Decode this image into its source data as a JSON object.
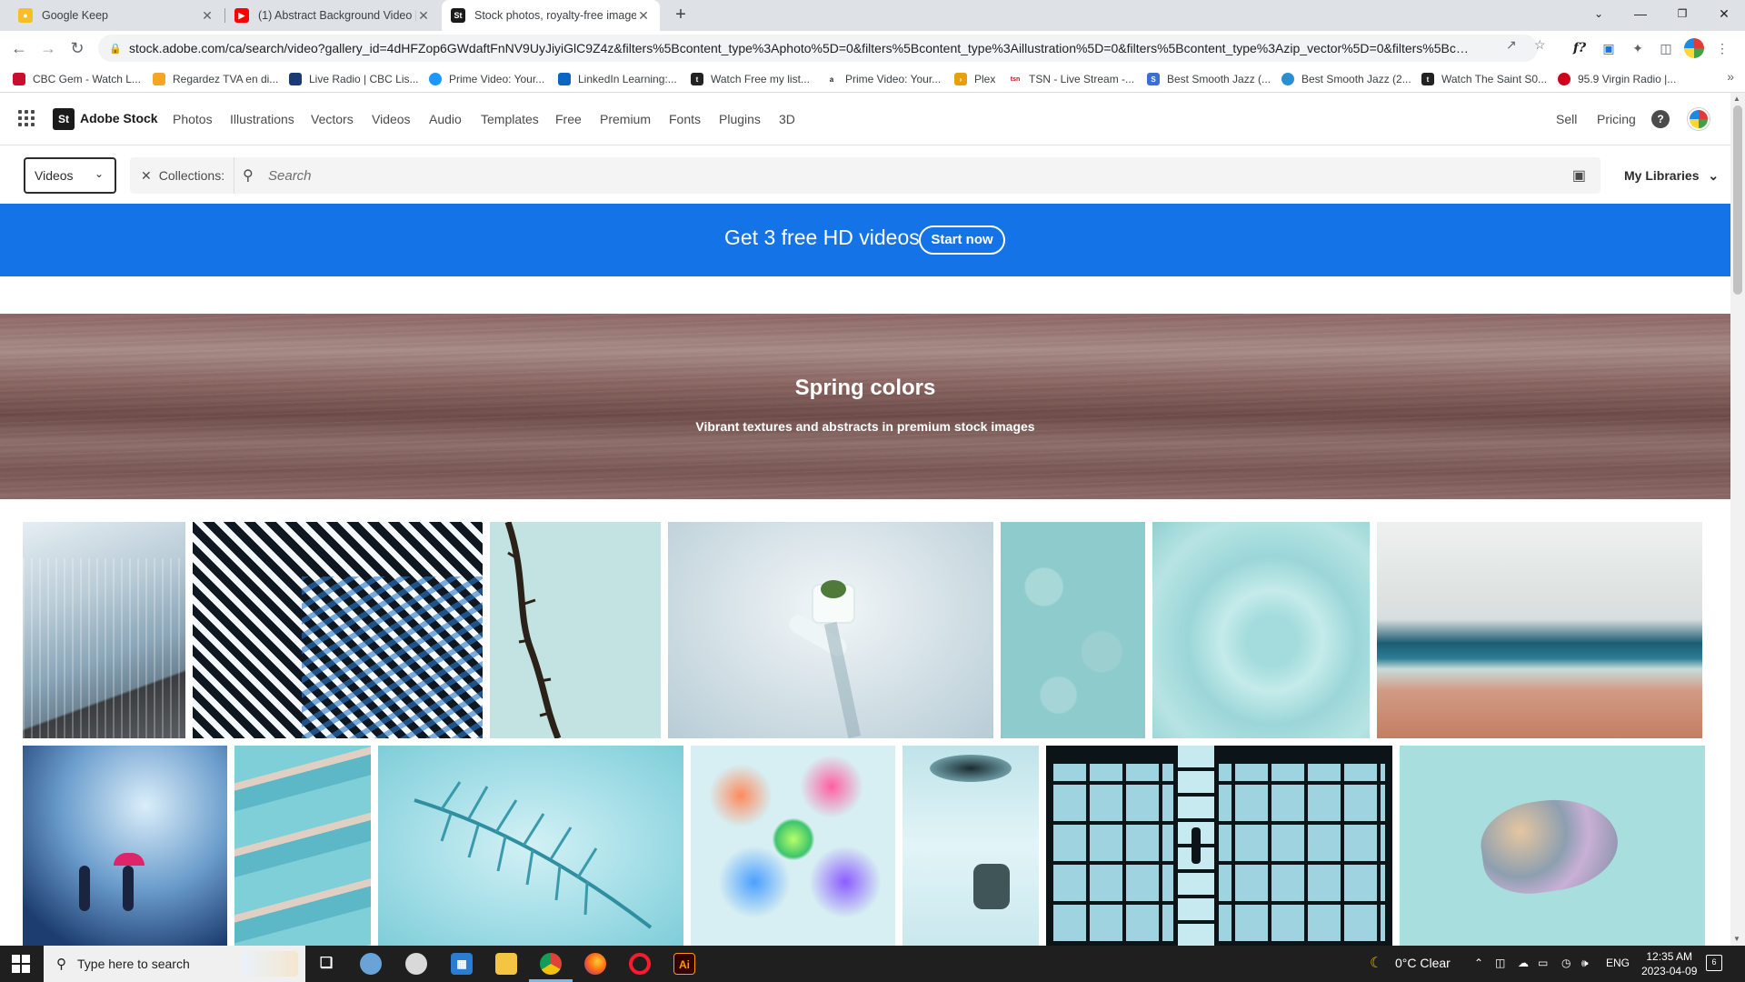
{
  "browser": {
    "tabs": [
      {
        "title": "Google Keep",
        "favicon": "keep-icon"
      },
      {
        "title": "(1) Abstract Background Video | ",
        "favicon": "youtube-icon"
      },
      {
        "title": "Stock photos, royalty-free image",
        "favicon": "adobe-stock-icon"
      }
    ],
    "url": "stock.adobe.com/ca/search/video?gallery_id=4dHFZop6GWdaftFnNV9UyJiyiGlC9Z4z&filters%5Bcontent_type%3Aphoto%5D=0&filters%5Bcontent_type%3Aillustration%5D=0&filters%5Bcontent_type%3Azip_vector%5D=0&filters%5Bcontent_t...",
    "bookmarks": [
      {
        "label": "CBC Gem - Watch L...",
        "color": "#c8102e"
      },
      {
        "label": "Regardez TVA en di...",
        "color": "#f5a623"
      },
      {
        "label": "Live Radio | CBC Lis...",
        "color": "#1a3b73"
      },
      {
        "label": "Prime Video: Your...",
        "color": "#1a98ff"
      },
      {
        "label": "LinkedIn Learning:...",
        "color": "#0a66c2"
      },
      {
        "label": "Watch Free my list...",
        "color": "#222222"
      },
      {
        "label": "Prime Video: Your...",
        "color": "#222222"
      },
      {
        "label": "Plex",
        "color": "#e5a00d"
      },
      {
        "label": "TSN - Live Stream -...",
        "color": "#d0021b"
      },
      {
        "label": "Best Smooth Jazz (...",
        "color": "#3b6fd8"
      },
      {
        "label": "Best Smooth Jazz (2...",
        "color": "#2a8fd0"
      },
      {
        "label": "Watch The Saint S0...",
        "color": "#222222"
      },
      {
        "label": "95.9 Virgin Radio |...",
        "color": "#d0021b"
      }
    ]
  },
  "stock": {
    "brand": "Adobe Stock",
    "logo_text": "St",
    "nav": [
      "Photos",
      "Illustrations",
      "Vectors",
      "Videos",
      "Audio",
      "Templates",
      "Free",
      "Premium",
      "Fonts",
      "Plugins",
      "3D"
    ],
    "nav_right": {
      "sell": "Sell",
      "pricing": "Pricing",
      "help": "?"
    },
    "search": {
      "type_selected": "Videos",
      "collections_label": "Collections:",
      "placeholder": "Search",
      "my_libraries": "My Libraries"
    },
    "promo": {
      "text": "Get 3 free HD videos",
      "button": "Start now",
      "color": "#1473e6"
    },
    "hero": {
      "title": "Spring colors",
      "subtitle": "Vibrant textures and abstracts in premium stock images"
    },
    "gallery_row1": [
      "blue-metal-building-wall",
      "black-blue-diagonal-stripes",
      "thorny-branch-on-mint",
      "toothbrush-with-plant-on-ice",
      "turquoise-cell-texture",
      "mint-cream-swirl",
      "turquoise-sea-and-beach"
    ],
    "gallery_row2": [
      "rainy-window-couple-umbrella",
      "pool-steps-turquoise",
      "palm-leaf-shadow-water",
      "colorful-smoke-rings",
      "glass-in-water-splash",
      "ladder-in-glass-skylight",
      "painted-rock-on-mint"
    ]
  },
  "taskbar": {
    "search_placeholder": "Type here to search",
    "weather": "0°C  Clear",
    "language": "ENG",
    "time": "12:35 AM",
    "date": "2023-04-09",
    "notifications": "6"
  }
}
